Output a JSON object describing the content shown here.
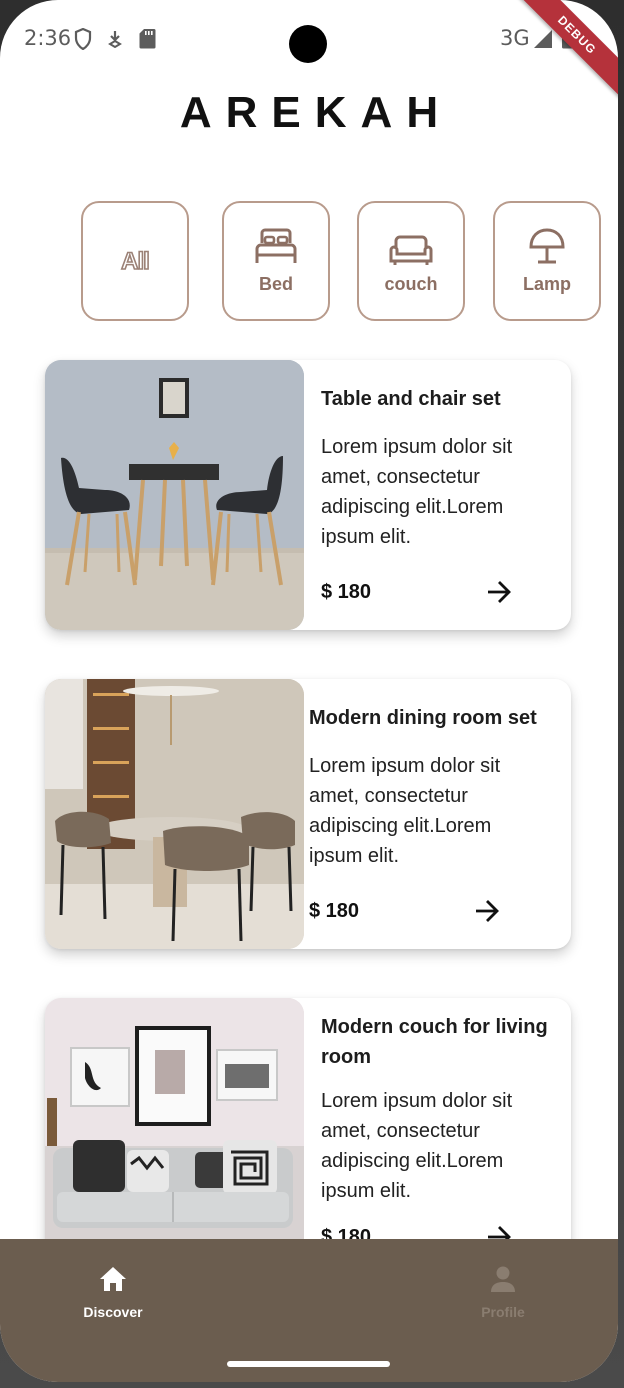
{
  "status_bar": {
    "time": "2:36",
    "network": "3G",
    "debug_banner": "DEBUG"
  },
  "app": {
    "title": "AREKAH"
  },
  "categories": [
    {
      "label": "All",
      "icon": "all-text-icon"
    },
    {
      "label": "Bed",
      "icon": "bed-icon"
    },
    {
      "label": "couch",
      "icon": "couch-icon"
    },
    {
      "label": "Lamp",
      "icon": "lamp-icon"
    }
  ],
  "products": [
    {
      "title": "Table and chair set",
      "description": "Lorem ipsum dolor sit amet, consectetur adipiscing elit.Lorem ipsum elit.",
      "price": "$ 180",
      "image": "table-chair-photo"
    },
    {
      "title": "Modern dining room set",
      "description": "Lorem ipsum dolor sit amet, consectetur adipiscing elit.Lorem ipsum elit.",
      "price": "$ 180",
      "image": "dining-room-photo"
    },
    {
      "title": "Modern couch for living room",
      "description": "Lorem ipsum dolor sit amet, consectetur adipiscing elit.Lorem ipsum elit.",
      "price": "$ 180",
      "image": "living-room-photo"
    }
  ],
  "bottom_nav": {
    "items": [
      {
        "label": "Discover",
        "icon": "home-icon",
        "active": true
      },
      {
        "label": "Profile",
        "icon": "person-icon",
        "active": false
      }
    ]
  },
  "colors": {
    "accent": "#6b5d4f",
    "category_border": "#b89b8c",
    "nav_active": "#ffffff",
    "nav_inactive": "#8a7d70"
  }
}
